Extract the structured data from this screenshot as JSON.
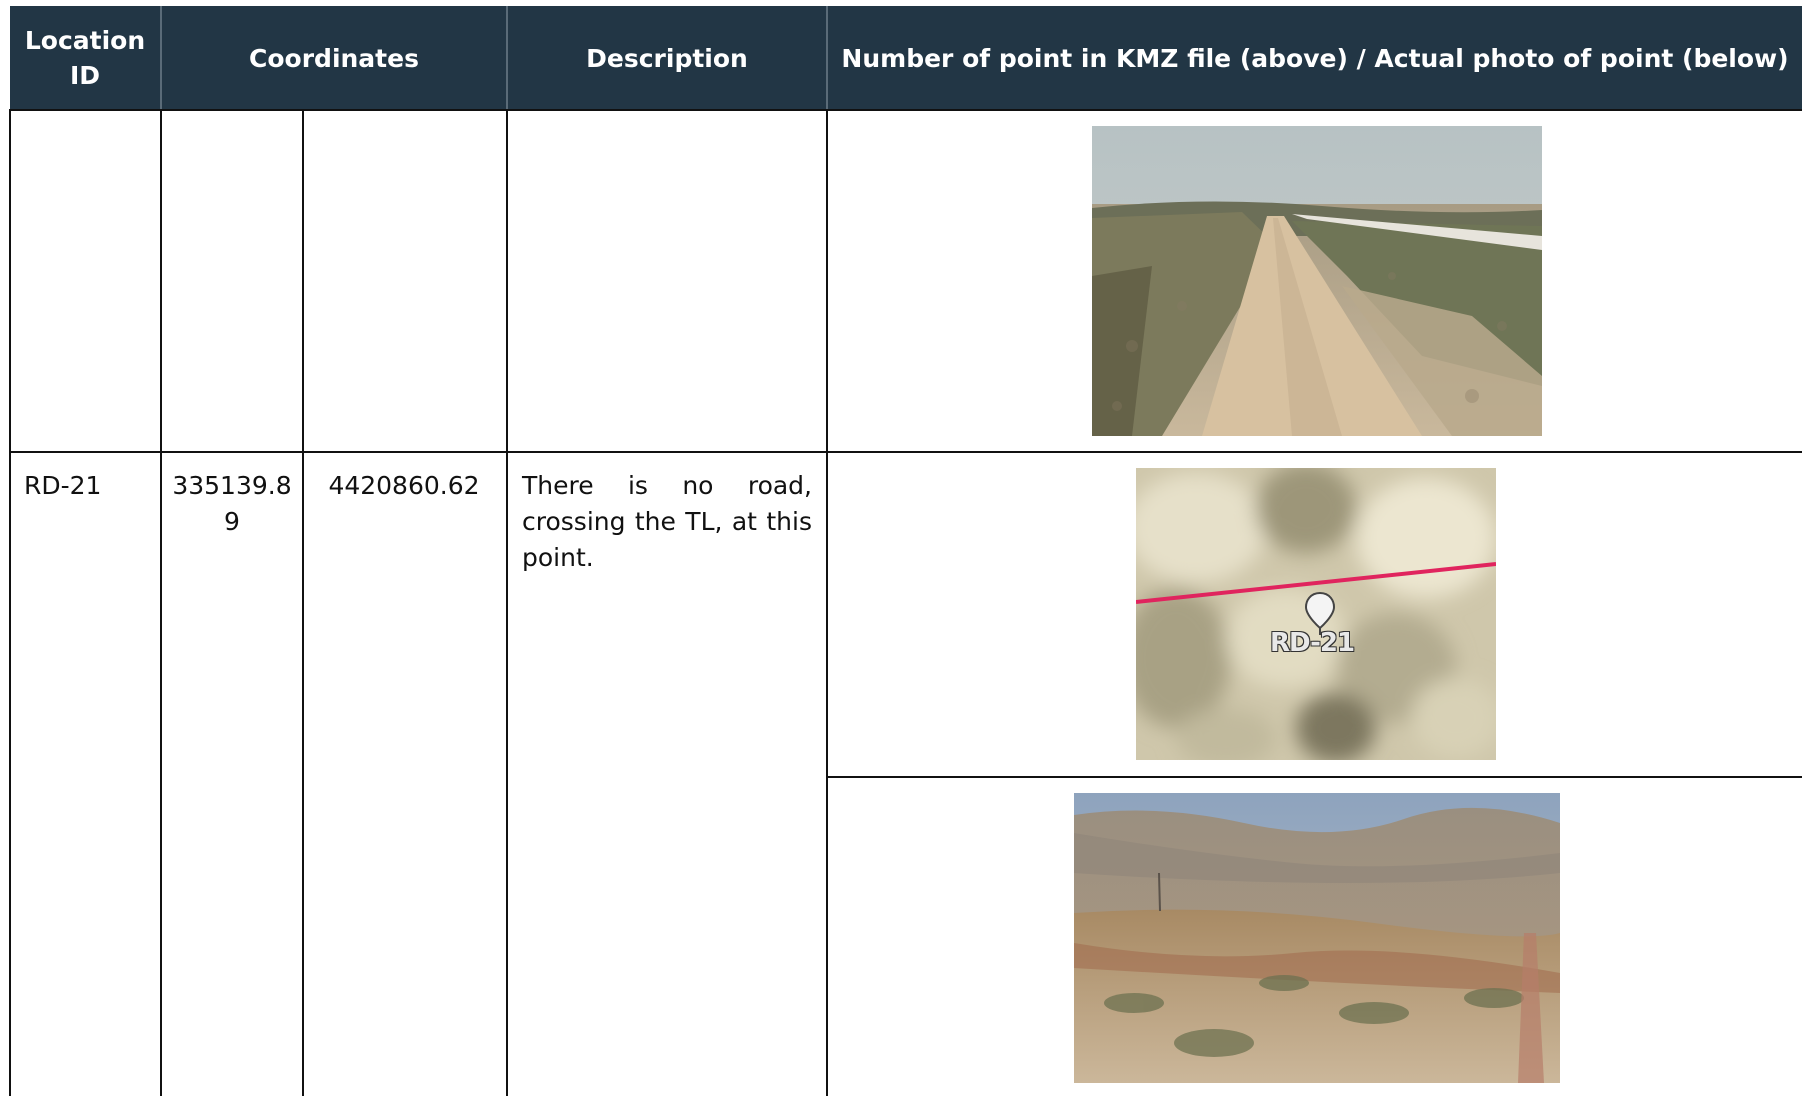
{
  "table": {
    "headers": {
      "location_id": "Location ID",
      "coordinates": "Coordinates",
      "description": "Description",
      "media": "Number of point in KMZ file (above) / Actual photo of point (below)"
    },
    "rows": [
      {
        "location_id": "",
        "x": "",
        "y": "",
        "description": "",
        "photos": [
          "road-track-photo"
        ]
      },
      {
        "location_id": "RD-21",
        "x": "335139.8 9",
        "y": "4420860.62",
        "description": "There is no road, crossing the TL, at this point.",
        "kmz_label": "RD-21",
        "photos": [
          "kmz-satellite-map",
          "hillside-photo"
        ]
      }
    ]
  },
  "colors": {
    "header_bg": "#223645",
    "header_text": "#ffffff",
    "kmz_line": "#e0245e"
  }
}
